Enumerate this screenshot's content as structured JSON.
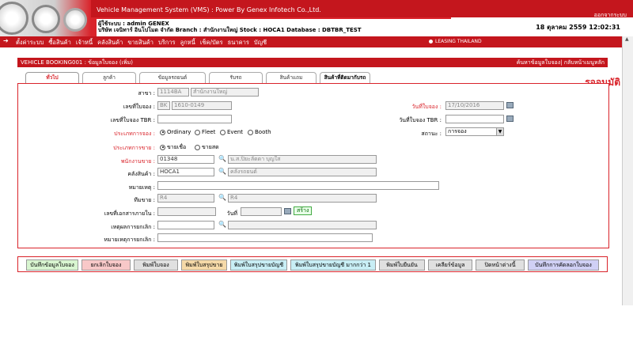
{
  "header": {
    "app_title": "Vehicle Management System (VMS)  : Power By Genex Infotech Co.,Ltd.",
    "logout": "ออกจากระบบ",
    "user_line": "ผู้ใช้ระบบ : admin GENEX",
    "company_line": "บริษัท เจนิทาร์ อินโปโมด จำกัด Branch : สำนักงานใหญ่ Stock : HOCA1 Database : DBTBR_TEST",
    "datetime": "18 ตุลาคม 2559 12:02:31"
  },
  "menu": {
    "arrow": "➔",
    "items": [
      "ตั้งค่าระบบ",
      "ซื้อสินค้า",
      "เจ้าหนี้",
      "คลังสินค้า",
      "ขายสินค้า",
      "บริการ",
      "ลูกหนี้",
      "เช็ค/บัตร",
      "ธนาคาร",
      "บัญชี"
    ],
    "leasing": "LEASING THAILAND"
  },
  "titlebar": {
    "title": "VEHICLE BOOKING001 : ข้อมูลใบจอง (เพิ่ม)",
    "right_links": "ค้นหาข้อมูลใบจอง| กลับหน้าเมนูหลัก"
  },
  "tabs": [
    "ทั่วไป",
    "ลูกค้า",
    "ข้อมูลรถยนต์",
    "รับรถ",
    "สินค้าแถม",
    "สินค้าที่ติดมากับรถ"
  ],
  "status": "รออนุมัติ",
  "form": {
    "branch_label": "สาขา :",
    "branch_code": "1114BA",
    "branch_name": "สำนักงานใหญ่",
    "booking_no_label": "เลขที่ใบจอง :",
    "booking_prefix": "BK",
    "booking_no": "1610-0149",
    "booking_date_label": "วันที่ใบจอง :",
    "booking_date": "17/10/2016",
    "tbr_no_label": "เลขที่ใบจอง TBR :",
    "tbr_no": "",
    "tbr_date_label": "วันที่ใบจอง TBR :",
    "tbr_date": "",
    "booking_type_label": "ประเภทการจอง :",
    "booking_types": [
      "Ordinary",
      "Fleet",
      "Event",
      "Booth"
    ],
    "status_label": "สถานะ :",
    "status_value": "การจอง",
    "sale_type_label": "ประเภทการขาย :",
    "sale_types": [
      "ขายเชื่อ",
      "ขายสด"
    ],
    "salesperson_label": "พนักงานขาย :",
    "salesperson_code": "01348",
    "salesperson_name": "น.ส.ปิยะลัดดา บุญใส",
    "warehouse_label": "คลังสินค้า :",
    "warehouse_code": "HOCA1",
    "warehouse_name": "คลังรถยนต์",
    "remark_label": "หมายเหตุ :",
    "remark": "",
    "zone_label": "ทีมขาย :",
    "zone_code": "R4",
    "zone_name": "R4",
    "doc_no_label": "เลขที่เอกสารภายใน :",
    "doc_no": "",
    "doc_date_label": "วันที่",
    "doc_date": "",
    "create_label": "สร้าง",
    "cancel_reason_label": "เหตุผลการยกเลิก :",
    "cancel_reason_code": "",
    "cancel_reason_name": "",
    "cancel_remark_label": "หมายเหตุการยกเลิก :",
    "cancel_remark": ""
  },
  "buttons": [
    {
      "label": "บันทึกข้อมูลใบจอง",
      "color": "#d8f5d0"
    },
    {
      "label": "ยกเลิกใบจอง",
      "color": "#f8c8c8"
    },
    {
      "label": "พิมพ์ใบจอง",
      "color": "#e0e0e0"
    },
    {
      "label": "พิมพ์ใบสรุปขาย",
      "color": "#f5d9a8"
    },
    {
      "label": "พิมพ์ใบสรุปขายบัญชี",
      "color": "#c8eef5"
    },
    {
      "label": "พิมพ์ใบสรุปขายบัญชี มากกว่า 1",
      "color": "#c8eef5"
    },
    {
      "label": "พิมพ์ใบยืนยัน",
      "color": "#e0e0e0"
    },
    {
      "label": "เคลียร์ข้อมูล",
      "color": "#e0e0e0"
    },
    {
      "label": "ปิดหน้าต่างนี้",
      "color": "#e0e0e0"
    },
    {
      "label": "บันทึกการคัดลอกใบจอง",
      "color": "#d0d0f5"
    }
  ]
}
